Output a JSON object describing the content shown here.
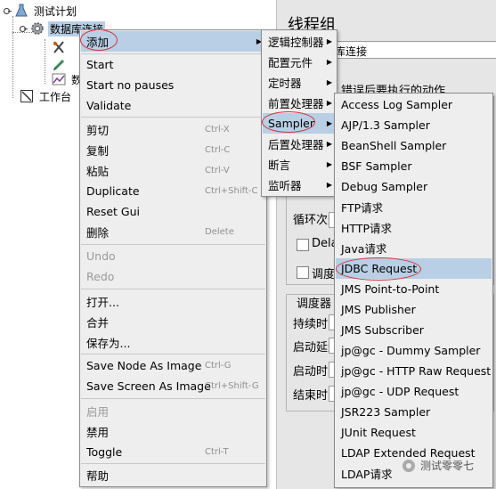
{
  "tree": {
    "test_plan": "测试计划",
    "thread_group": "数据库连接",
    "workbench": "工作台",
    "child_trunc": "数"
  },
  "panel": {
    "title": "线程组",
    "name_value": "据库连接",
    "error_action": "错误后要执行的动作",
    "loop_count": "循环次数",
    "delay": "Delay",
    "scheduler": "调度",
    "scheduler_config": "调度器",
    "duration": "持续时间",
    "startup_delay": "启动延迟",
    "start_time": "启动时间",
    "end_time": "结束时间"
  },
  "context_menu": {
    "items": [
      {
        "label": "添加",
        "submenu": true,
        "highlighted": true
      },
      {
        "label": "Start"
      },
      {
        "label": "Start no pauses"
      },
      {
        "label": "Validate"
      },
      {
        "label": "剪切",
        "shortcut": "Ctrl-X"
      },
      {
        "label": "复制",
        "shortcut": "Ctrl-C"
      },
      {
        "label": "粘贴",
        "shortcut": "Ctrl-V"
      },
      {
        "label": "Duplicate",
        "shortcut": "Ctrl+Shift-C"
      },
      {
        "label": "Reset Gui"
      },
      {
        "label": "删除",
        "shortcut": "Delete"
      },
      {
        "label": "Undo",
        "disabled": true
      },
      {
        "label": "Redo",
        "disabled": true
      },
      {
        "label": "打开..."
      },
      {
        "label": "合并"
      },
      {
        "label": "保存为..."
      },
      {
        "label": "Save Node As Image",
        "shortcut": "Ctrl-G"
      },
      {
        "label": "Save Screen As Image",
        "shortcut": "Ctrl+Shift-G"
      },
      {
        "label": "启用",
        "disabled": true
      },
      {
        "label": "禁用"
      },
      {
        "label": "Toggle",
        "shortcut": "Ctrl-T"
      },
      {
        "label": "帮助"
      }
    ]
  },
  "add_submenu": {
    "items": [
      {
        "label": "逻辑控制器"
      },
      {
        "label": "配置元件"
      },
      {
        "label": "定时器"
      },
      {
        "label": "前置处理器"
      },
      {
        "label": "Sampler",
        "highlighted": true
      },
      {
        "label": "后置处理器"
      },
      {
        "label": "断言"
      },
      {
        "label": "监听器"
      }
    ]
  },
  "sampler_submenu": {
    "items": [
      {
        "label": "Access Log Sampler"
      },
      {
        "label": "AJP/1.3 Sampler"
      },
      {
        "label": "BeanShell Sampler"
      },
      {
        "label": "BSF Sampler"
      },
      {
        "label": "Debug Sampler"
      },
      {
        "label": "FTP请求"
      },
      {
        "label": "HTTP请求"
      },
      {
        "label": "Java请求"
      },
      {
        "label": "JDBC Request",
        "highlighted": true
      },
      {
        "label": "JMS Point-to-Point"
      },
      {
        "label": "JMS Publisher"
      },
      {
        "label": "JMS Subscriber"
      },
      {
        "label": "jp@gc - Dummy Sampler"
      },
      {
        "label": "jp@gc - HTTP Raw Request"
      },
      {
        "label": "jp@gc - UDP Request"
      },
      {
        "label": "JSR223 Sampler"
      },
      {
        "label": "JUnit Request"
      },
      {
        "label": "LDAP Extended Request"
      },
      {
        "label": "LDAP请求"
      }
    ]
  },
  "watermark": "测试零零七",
  "colors": {
    "highlight": "#b8cfe5",
    "menu_bg": "#eeeeee",
    "annotation_red": "#d9303a"
  }
}
